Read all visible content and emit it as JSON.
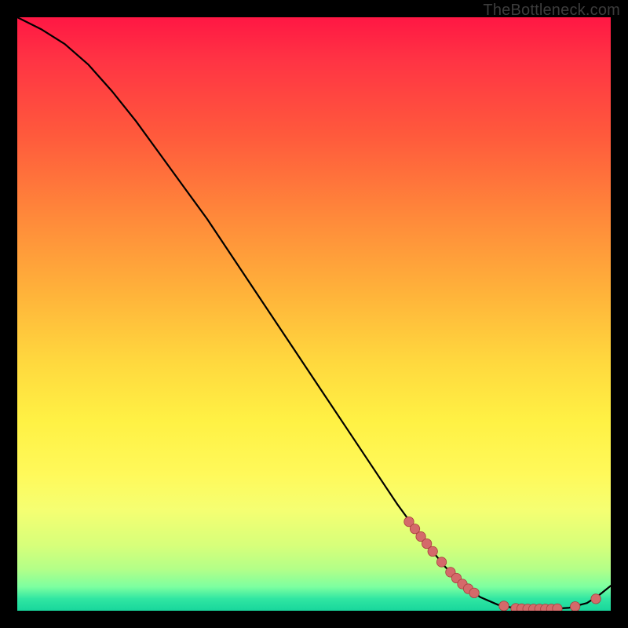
{
  "watermark": {
    "text": "TheBottleneck.com"
  },
  "colors": {
    "line": "#000000",
    "marker_fill": "#d46a6a",
    "marker_stroke": "#a83e3e"
  },
  "chart_data": {
    "type": "line",
    "title": "",
    "xlabel": "",
    "ylabel": "",
    "xlim": [
      0,
      100
    ],
    "ylim": [
      0,
      100
    ],
    "grid": false,
    "legend": false,
    "series": [
      {
        "name": "curve",
        "x": [
          0,
          4,
          8,
          12,
          16,
          20,
          24,
          28,
          32,
          36,
          40,
          44,
          48,
          52,
          56,
          60,
          64,
          68,
          70,
          72,
          75,
          78,
          81,
          84,
          86,
          88,
          90,
          93,
          96,
          98,
          100
        ],
        "y": [
          100,
          98,
          95.5,
          92,
          87.5,
          82.5,
          77,
          71.5,
          66,
          60,
          54,
          48,
          42,
          36,
          30,
          24,
          18,
          12.5,
          10,
          7.5,
          4.5,
          2.3,
          1.0,
          0.4,
          0.3,
          0.3,
          0.3,
          0.5,
          1.3,
          2.6,
          4.2
        ]
      }
    ],
    "markers": {
      "name": "highlighted-points",
      "x": [
        66,
        67,
        68,
        69,
        70,
        71.5,
        73,
        74,
        75,
        76,
        77,
        82,
        84,
        85,
        86,
        87,
        88,
        89,
        90,
        91,
        94,
        97.5
      ],
      "y": [
        15.0,
        13.8,
        12.5,
        11.3,
        10.0,
        8.2,
        6.5,
        5.5,
        4.5,
        3.7,
        3.0,
        0.8,
        0.4,
        0.35,
        0.3,
        0.3,
        0.3,
        0.3,
        0.3,
        0.35,
        0.7,
        2.0
      ]
    }
  }
}
